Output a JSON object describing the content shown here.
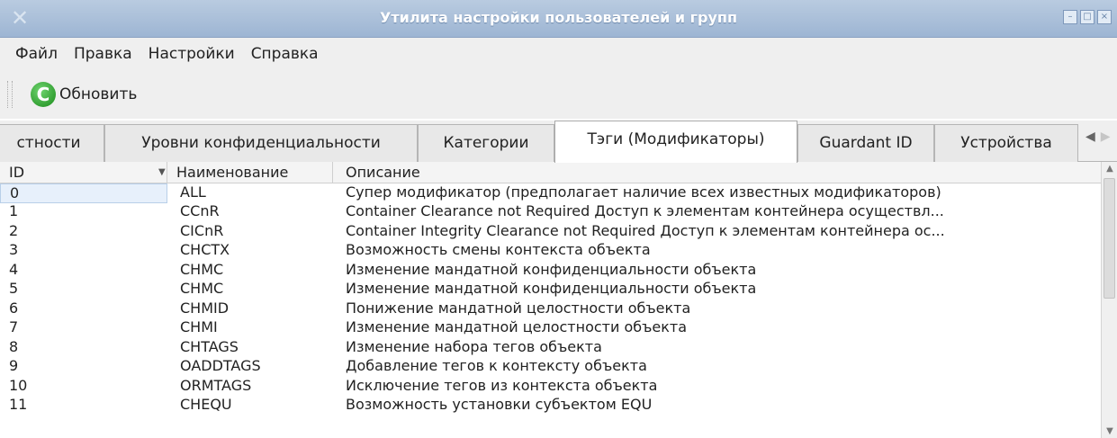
{
  "window": {
    "title": "Утилита настройки пользователей и групп"
  },
  "menubar": {
    "items": [
      "Файл",
      "Правка",
      "Настройки",
      "Справка"
    ]
  },
  "toolbar": {
    "refresh_label": "Обновить"
  },
  "tabs": [
    {
      "label": "стности"
    },
    {
      "label": "Уровни конфиденциальности"
    },
    {
      "label": "Категории"
    },
    {
      "label": "Тэги (Модификаторы)",
      "active": true
    },
    {
      "label": "Guardant ID"
    },
    {
      "label": "Устройства"
    }
  ],
  "table": {
    "columns": {
      "id": "ID",
      "name": "Наименование",
      "desc": "Описание"
    },
    "rows": [
      {
        "id": "0",
        "name": "ALL",
        "desc": "Супер модификатор (предполагает наличие всех известных модификаторов)"
      },
      {
        "id": "1",
        "name": "CCnR",
        "desc": "Container Clearance not Required Доступ к элементам контейнера осуществл..."
      },
      {
        "id": "2",
        "name": "CICnR",
        "desc": "Container Integrity Clearance not Required Доступ к элементам контейнера ос..."
      },
      {
        "id": "3",
        "name": "CHCTX",
        "desc": "Возможность смены контекста объекта"
      },
      {
        "id": "4",
        "name": "CHMC",
        "desc": "Изменение мандатной конфиденциальности объекта"
      },
      {
        "id": "5",
        "name": "CHMC",
        "desc": "Изменение мандатной конфиденциальности объекта"
      },
      {
        "id": "6",
        "name": "CHMID",
        "desc": "Понижение мандатной целостности объекта"
      },
      {
        "id": "7",
        "name": "CHMI",
        "desc": "Изменение мандатной целостности объекта"
      },
      {
        "id": "8",
        "name": "CHTAGS",
        "desc": "Изменение набора тегов объекта"
      },
      {
        "id": "9",
        "name": "OADDTAGS",
        "desc": "Добавление тегов к контексту объекта"
      },
      {
        "id": "10",
        "name": "ORMTAGS",
        "desc": "Исключение тегов из контекста объекта"
      },
      {
        "id": "11",
        "name": "CHEQU",
        "desc": "Возможность установки субъектом EQU"
      }
    ]
  }
}
